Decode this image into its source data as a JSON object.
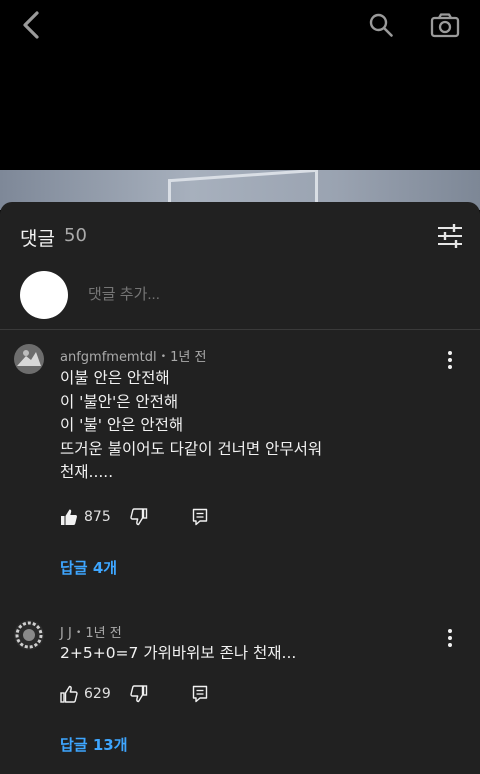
{
  "topbar": {
    "back_icon": "chevron-left-icon",
    "search_icon": "search-icon",
    "camera_icon": "camera-icon"
  },
  "comments_panel": {
    "title": "댓글",
    "count": "50",
    "filter_icon": "sliders-icon",
    "add_comment_placeholder": "댓글 추가..."
  },
  "comments": [
    {
      "author": "anfgmfmemtdl",
      "time": "1년 전",
      "text": "이불 안은 안전해\n이 '불안'은 안전해\n이 '불' 안은 안전해\n뜨거운 불이어도 다같이 건너면 안무서워\n천재.....",
      "likes": "875",
      "liked": true,
      "replies_label": "답글 4개"
    },
    {
      "author": "J J",
      "time": "1년 전",
      "text": "2+5+0=7 가위바위보 존나 천재...",
      "likes": "629",
      "liked": false,
      "replies_label": "답글 13개"
    }
  ],
  "meta_separator": "•",
  "colors": {
    "sheet_bg": "#212121",
    "link_blue": "#3ea6ff",
    "muted": "#aaaaaa"
  }
}
